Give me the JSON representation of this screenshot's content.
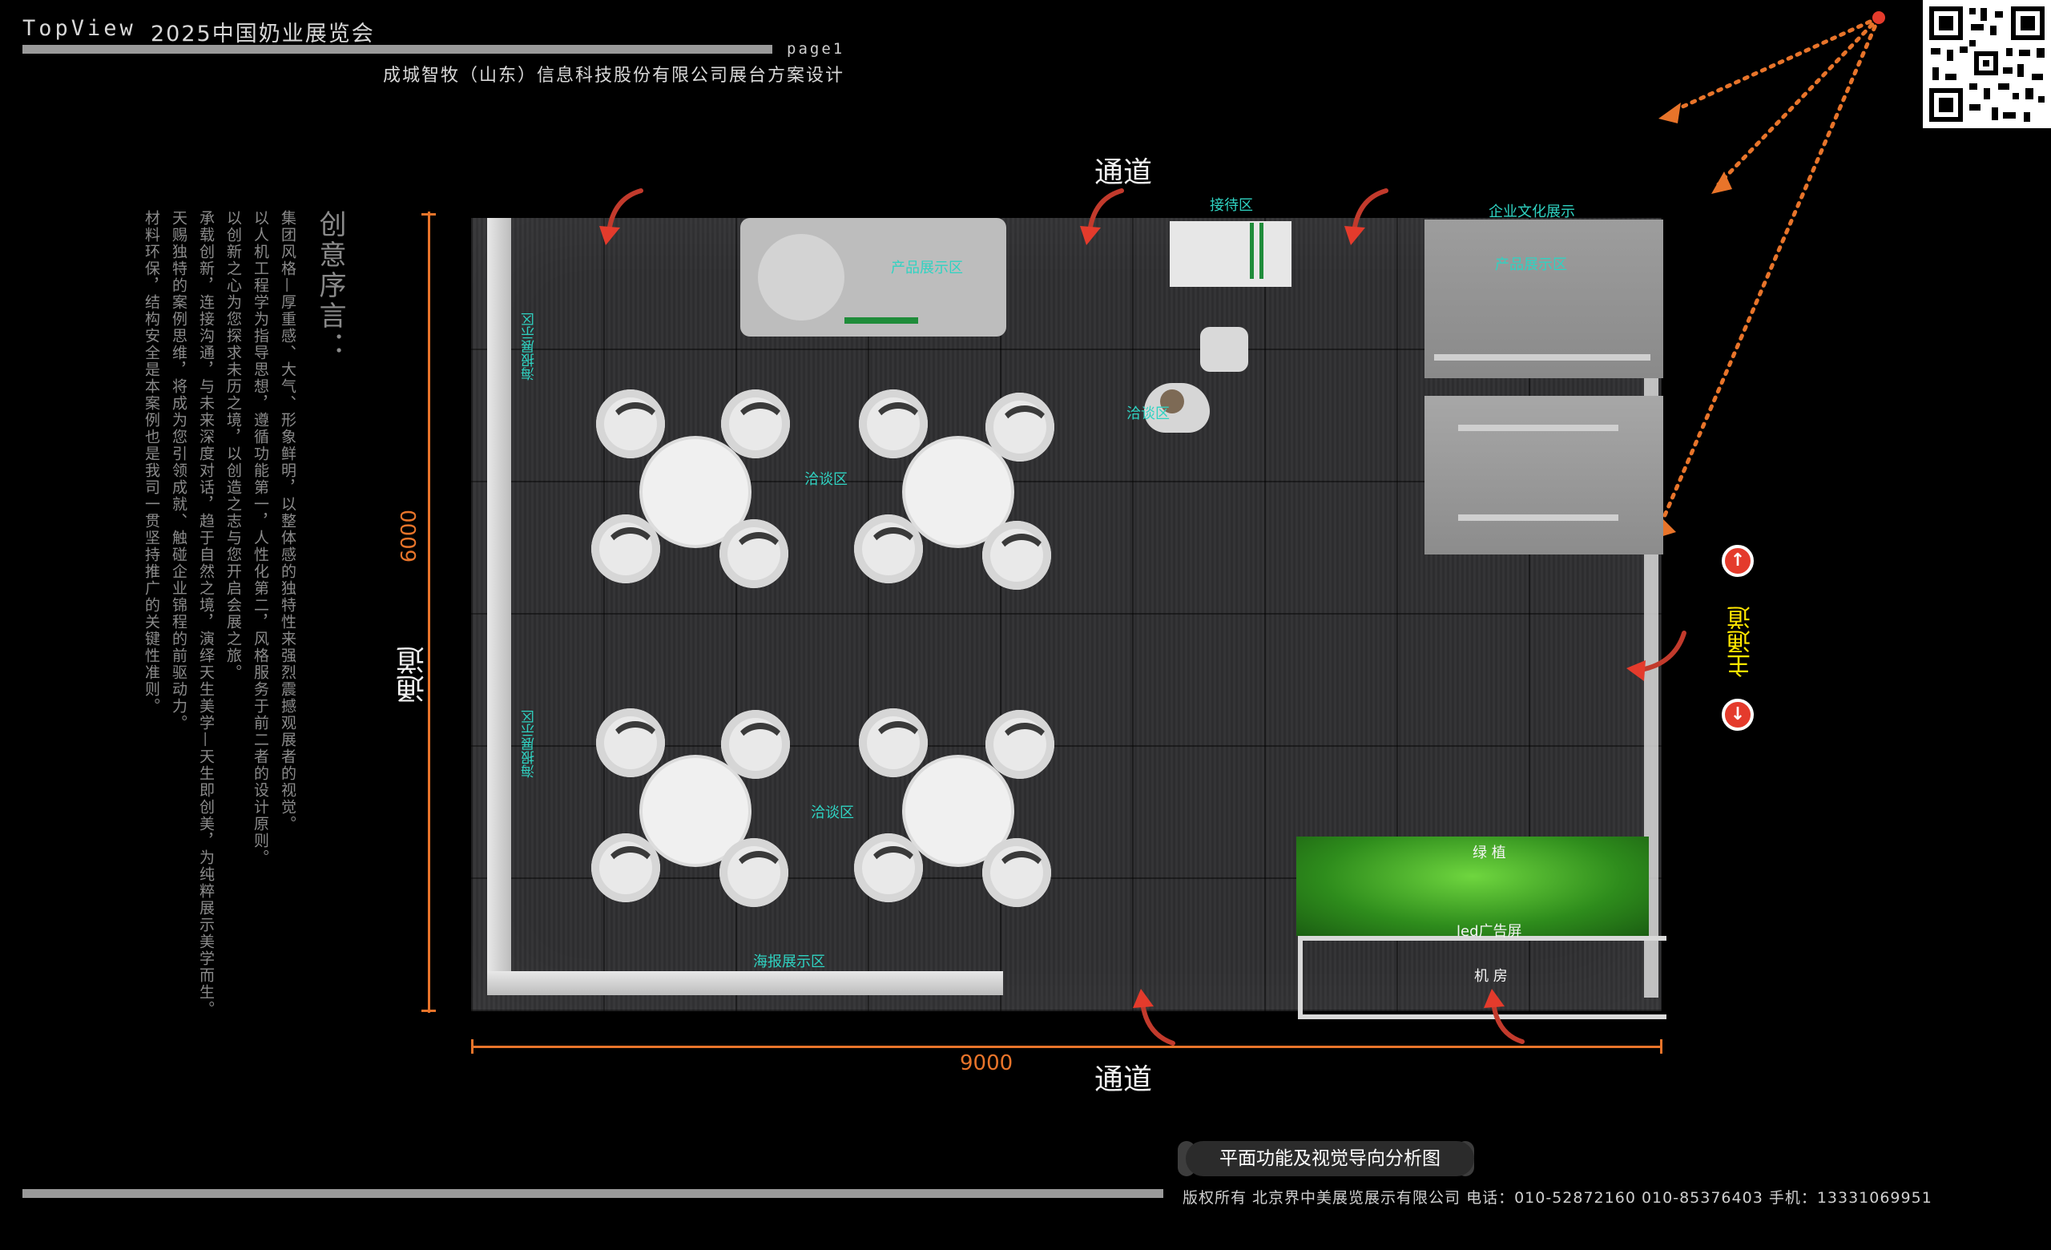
{
  "header": {
    "brand": "TopView",
    "title": "2025中国奶业展览会",
    "page": "page1",
    "company": "成城智牧（山东）信息科技股份有限公司展台方案设计"
  },
  "preface": {
    "title": "创意序言：",
    "items": [
      "集团风格—厚重感、大气、形象鲜明，以整体感的独特性来强烈震撼观展者的视觉。",
      "以人机工程学为指导思想，遵循功能第一，人性化第二，风格服务于前二者的设计原则。",
      "以创新之心为您探求未历之境，以创造之志与您开启会展之旅。",
      "承载创新，连接沟通，与未来深度对话，趋于自然之境，演绎天生美学—天生即创美，为纯粹展示美学而生。",
      "天赐独特的案例思维，将成为您引领成就、触碰企业锦程的前驱动力。",
      "材料环保，结构安全是本案例也是我司一贯坚持推广的关键性准则。"
    ]
  },
  "plan": {
    "aisle_top": "通道",
    "aisle_left": "通道",
    "aisle_bottom": "通道",
    "main_aisle": "主通道",
    "width_dim": "9000",
    "depth_dim": "6000",
    "zones": {
      "reception": "接待区",
      "culture": "企业文化展示",
      "product_top": "产品展示区",
      "product_right": "产品展示区",
      "poster_left_top": "海报展示区",
      "poster_left_bottom": "海报展示区",
      "poster_bottom": "海报展示区",
      "talk_top": "洽谈区",
      "talk_bottom": "洽谈区",
      "talk_person": "洽谈区",
      "green": "绿 植",
      "led": "led广告屏",
      "machine": "机 房"
    }
  },
  "caption": "平面功能及视觉导向分析图",
  "footer": "版权所有  北京界中美展览展示有限公司  电话：010-52872160  010-85376403  手机：13331069951",
  "colors": {
    "accent": "#e8742a",
    "zone_label": "#2fd3c2",
    "main_aisle": "#ffe600",
    "arrow": "#e43b2c",
    "grass": "#4cb52b"
  },
  "icons": [
    "qr-code-icon",
    "entry-arrow-icon",
    "up-arrow-icon",
    "down-arrow-icon",
    "sightline-arrow-icon"
  ]
}
